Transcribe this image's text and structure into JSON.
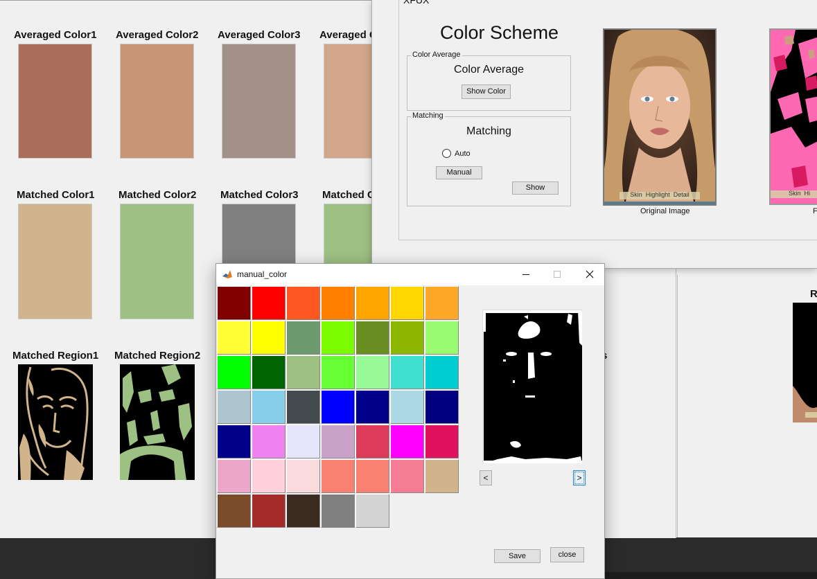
{
  "results": {
    "averaged": [
      {
        "label": "Averaged Color1",
        "color": "#a96d5a"
      },
      {
        "label": "Averaged Color2",
        "color": "#c99577"
      },
      {
        "label": "Averaged Color3",
        "color": "#a39189"
      },
      {
        "label": "Averaged C",
        "color": "#d2a68b"
      }
    ],
    "matched": [
      {
        "label": "Matched Color1",
        "color": "#d2b48c"
      },
      {
        "label": "Matched Color2",
        "color": "#9dc183"
      },
      {
        "label": "Matched Color3",
        "color": "#808080"
      },
      {
        "label": "Matched C",
        "color": "#9dc183"
      }
    ],
    "regions": [
      {
        "label": "Matched Region1",
        "color": "#d2b48c"
      },
      {
        "label": "Matched Region2",
        "color": "#9dc183"
      }
    ],
    "partial_r": "R",
    "partial_s": "s"
  },
  "main": {
    "title_fragment": "XFUX",
    "heading": "Color Scheme",
    "color_average_group": {
      "legend": "Color Average",
      "title": "Color Average",
      "button": "Show Color"
    },
    "matching_group": {
      "legend": "Matching",
      "title": "Matching",
      "radio_label": "Auto",
      "manual_button": "Manual",
      "show_button": "Show"
    },
    "original_caption": "Original Image",
    "partial_caption": "F",
    "overlay_tabs": "Skin  Highlight  Detail",
    "overlay_tabs_partial": "Skin  Hi"
  },
  "dialog": {
    "title": "manual_color",
    "palette": [
      "#800000",
      "#ff0000",
      "#ff5722",
      "#ff8000",
      "#ffa500",
      "#ffd700",
      "#ffa726",
      "#ffff33",
      "#ffff00",
      "#6b9a6f",
      "#7cfc00",
      "#6b8e23",
      "#8db600",
      "#98fb70",
      "#00ff00",
      "#006400",
      "#9dc183",
      "#66ff33",
      "#98fb98",
      "#40e0d0",
      "#00ced1",
      "#aec6cf",
      "#87ceeb",
      "#444b4e",
      "#0000ff",
      "#00008b",
      "#add8e6",
      "#000080",
      "#00008b",
      "#ee82ee",
      "#e6e6fa",
      "#c8a2c8",
      "#dc3c5a",
      "#ff00ff",
      "#e0115f",
      "#eba6c9",
      "#ffd1dc",
      "#fadadd",
      "#fa8072",
      "#fa8072",
      "#f47c94",
      "#d2b48c",
      "#7b4b2a",
      "#a52a2a",
      "#3b2a20",
      "#808080",
      "#d3d3d3"
    ],
    "prev_button": "<",
    "next_button": ">",
    "save_button": "Save",
    "close_button": "close"
  }
}
